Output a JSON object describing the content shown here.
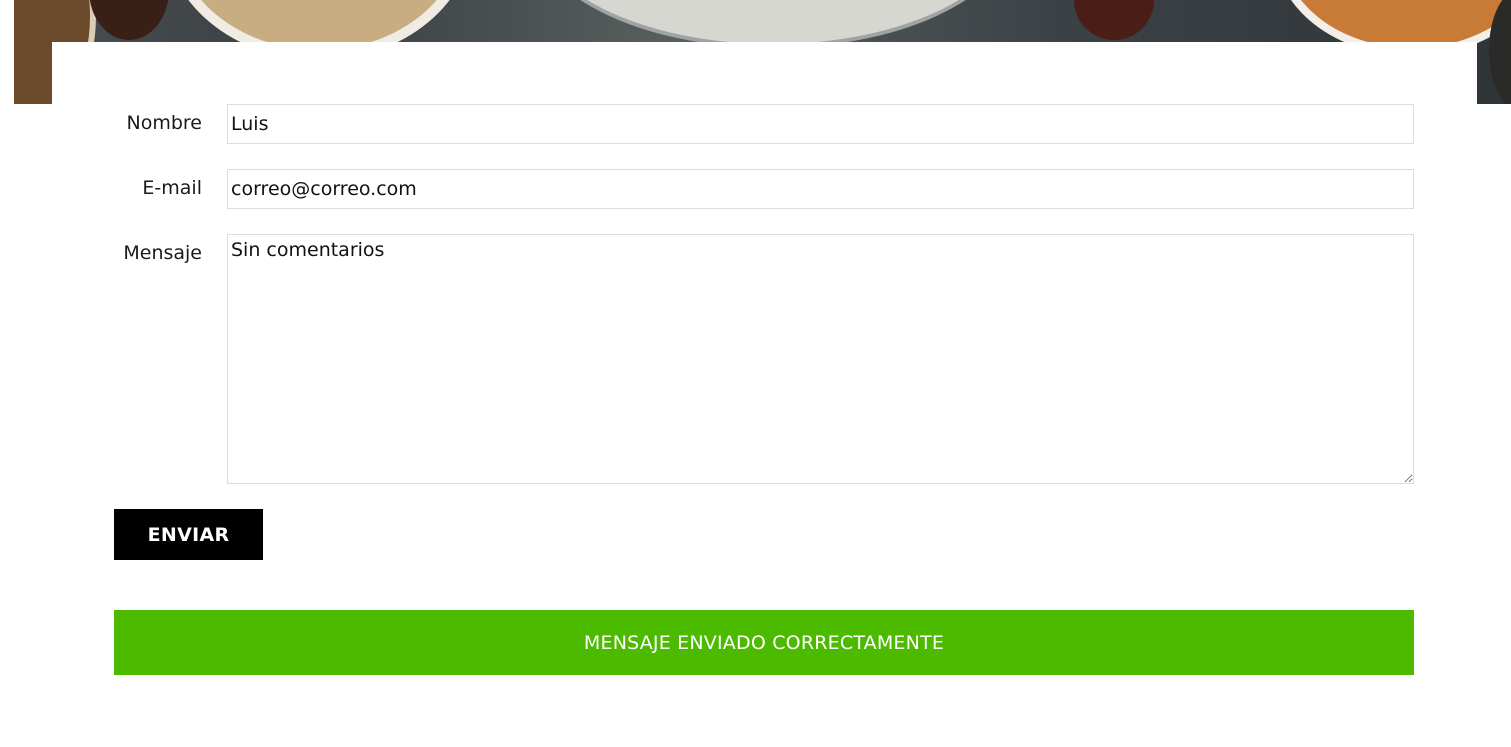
{
  "form": {
    "name_label": "Nombre",
    "name_value": "Luis",
    "email_label": "E-mail",
    "email_value": "correo@correo.com",
    "message_label": "Mensaje",
    "message_value": "Sin comentarios",
    "submit_label": "ENVIAR"
  },
  "status": {
    "message": "MENSAJE ENVIADO CORRECTAMENTE",
    "color": "#4cbb00"
  },
  "colors": {
    "button_bg": "#000000",
    "field_border": "#dcdcdc"
  }
}
